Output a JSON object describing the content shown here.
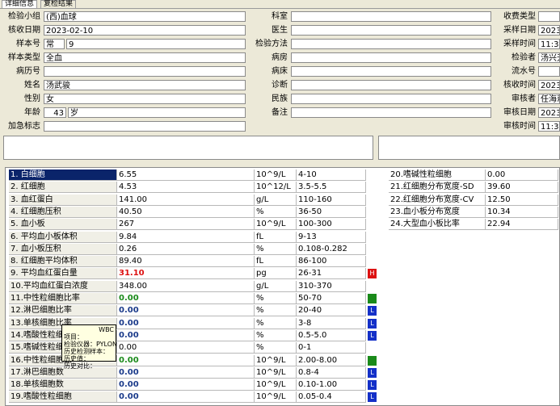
{
  "tabs": [
    "详细信息",
    "复检结果"
  ],
  "left_fields": [
    {
      "label": "检验小组",
      "value": "(西)血球"
    },
    {
      "label": "核收日期",
      "value": "2023-02-10"
    },
    {
      "label": "样本号",
      "value": "常",
      "value2": "9"
    },
    {
      "label": "样本类型",
      "value": "全血"
    },
    {
      "label": "病历号",
      "value": ""
    },
    {
      "label": "姓名",
      "value": "汤武骏"
    },
    {
      "label": "性别",
      "value": "女"
    },
    {
      "label": "年龄",
      "value": "43",
      "value2": "岁"
    },
    {
      "label": "加急标志",
      "value": ""
    }
  ],
  "mid_fields": [
    {
      "label": "科室",
      "value": ""
    },
    {
      "label": "医生",
      "value": ""
    },
    {
      "label": "检验方法",
      "value": ""
    },
    {
      "label": "病房",
      "value": ""
    },
    {
      "label": "病床",
      "value": ""
    },
    {
      "label": "诊断",
      "value": ""
    },
    {
      "label": "民族",
      "value": ""
    },
    {
      "label": "备注",
      "value": ""
    }
  ],
  "right_fields": [
    {
      "label": "收费类型",
      "value": ""
    },
    {
      "label": "采样日期",
      "value": "2023-"
    },
    {
      "label": "采样时间",
      "value": "11:35"
    },
    {
      "label": "检验者",
      "value": "汤兴无"
    },
    {
      "label": "流水号",
      "value": ""
    },
    {
      "label": "核收时间",
      "value": "2023-"
    },
    {
      "label": "审核者",
      "value": "任海莉"
    },
    {
      "label": "审核日期",
      "value": "2023-"
    },
    {
      "label": "审核时间",
      "value": "11:38"
    }
  ],
  "results_left": [
    {
      "name": "1. 白细胞",
      "value": "6.55",
      "unit": "10^9/L",
      "range": "4-10",
      "flag": "",
      "style": ""
    },
    {
      "name": "2. 红细胞",
      "value": "4.53",
      "unit": "10^12/L",
      "range": "3.5-5.5",
      "flag": "",
      "style": ""
    },
    {
      "name": "3. 血红蛋白",
      "value": "141.00",
      "unit": "g/L",
      "range": "110-160",
      "flag": "",
      "style": ""
    },
    {
      "name": "4. 红细胞压积",
      "value": "40.50",
      "unit": "%",
      "range": "36-50",
      "flag": "",
      "style": ""
    },
    {
      "name": "5. 血小板",
      "value": "267",
      "unit": "10^9/L",
      "range": "100-300",
      "flag": "",
      "style": ""
    },
    {
      "name": "6. 平均血小板体积",
      "value": "9.84",
      "unit": "fL",
      "range": "9-13",
      "flag": "",
      "style": ""
    },
    {
      "name": "7. 血小板压积",
      "value": "0.26",
      "unit": "%",
      "range": "0.108-0.282",
      "flag": "",
      "style": ""
    },
    {
      "name": "8. 红细胞平均体积",
      "value": "89.40",
      "unit": "fL",
      "range": "86-100",
      "flag": "",
      "style": ""
    },
    {
      "name": "9. 平均血红蛋白量",
      "value": "31.10",
      "unit": "pg",
      "range": "26-31",
      "flag": "H",
      "style": "red"
    },
    {
      "name": "10.平均血红蛋白浓度",
      "value": "348.00",
      "unit": "g/L",
      "range": "310-370",
      "flag": "",
      "style": ""
    },
    {
      "name": "11.中性粒细胞比率",
      "value": "0.00",
      "unit": "%",
      "range": "50-70",
      "flag": "N",
      "style": "grn"
    },
    {
      "name": "12.淋巴细胞比率",
      "value": "0.00",
      "unit": "%",
      "range": "20-40",
      "flag": "L",
      "style": "bold"
    },
    {
      "name": "13.单核细胞比率",
      "value": "0.00",
      "unit": "%",
      "range": "3-8",
      "flag": "L",
      "style": "bold"
    },
    {
      "name": "14.嗜酸性粒细胞比率",
      "value": "0.00",
      "unit": "%",
      "range": "0.5-5.0",
      "flag": "L",
      "style": "bold"
    },
    {
      "name": "15.嗜碱性粒细胞比率",
      "value": "0.00",
      "unit": "%",
      "range": "0-1",
      "flag": "",
      "style": ""
    },
    {
      "name": "16.中性粒细胞数",
      "value": "0.00",
      "unit": "10^9/L",
      "range": "2.00-8.00",
      "flag": "N",
      "style": "grn"
    },
    {
      "name": "17.淋巴细胞数",
      "value": "0.00",
      "unit": "10^9/L",
      "range": "0.8-4",
      "flag": "L",
      "style": "bold"
    },
    {
      "name": "18.单核细胞数",
      "value": "0.00",
      "unit": "10^9/L",
      "range": "0.10-1.00",
      "flag": "L",
      "style": "bold"
    },
    {
      "name": "19.嗜酸性粒细胞",
      "value": "0.00",
      "unit": "10^9/L",
      "range": "0.05-0.4",
      "flag": "L",
      "style": "bold"
    }
  ],
  "results_right": [
    {
      "name": "20.嗜碱性粒细胞",
      "value": "0.00"
    },
    {
      "name": "21.红细胞分布宽度-SD",
      "value": "39.60"
    },
    {
      "name": "22.红细胞分布宽度-CV",
      "value": "12.50"
    },
    {
      "name": "23.血小板分布宽度",
      "value": "10.34"
    },
    {
      "name": "24.大型血小板比率",
      "value": "22.94"
    }
  ],
  "tooltip": {
    "title": "WBC",
    "lines": [
      "项目：",
      "检验仪器：PYLON",
      "历史检测样本：",
      "历史值：",
      "历史对比："
    ]
  },
  "colors": {
    "high": "#d11",
    "low": "#1430c8",
    "normal": "#1a8a1a",
    "selection": "#0a246a"
  }
}
